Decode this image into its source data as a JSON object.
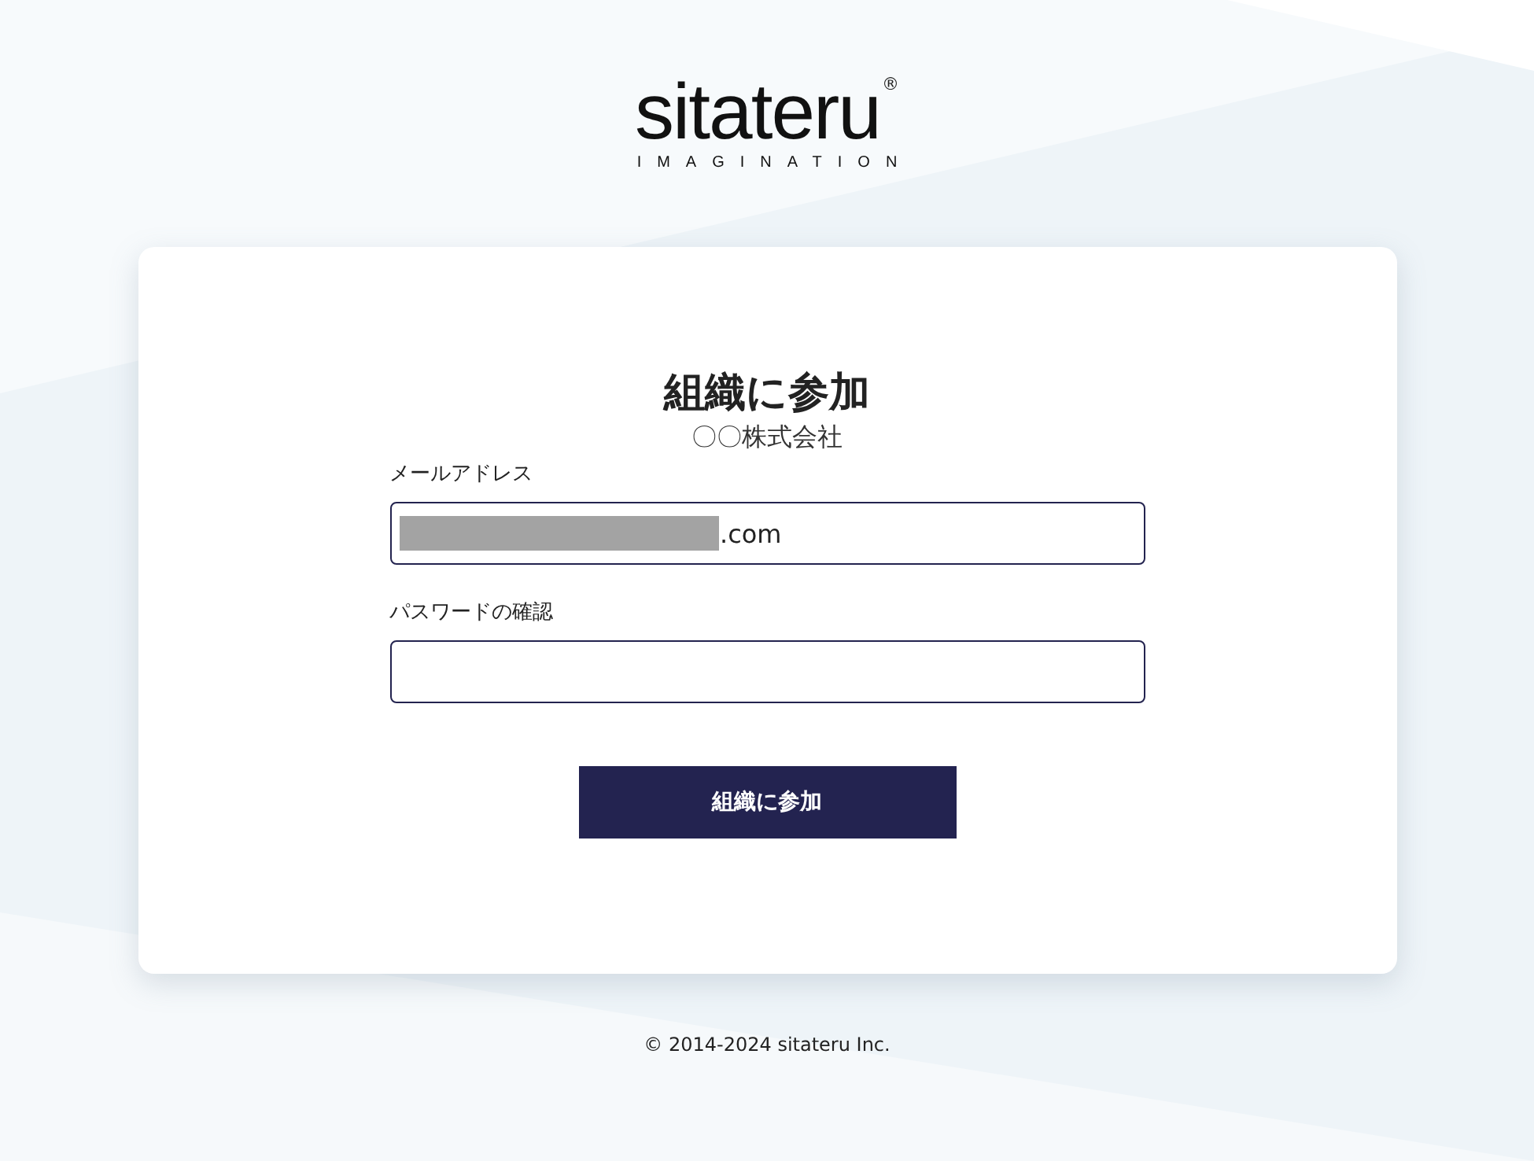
{
  "logo": {
    "wordmark": "sitateru",
    "registered": "®",
    "tagline": "IMAGINATION"
  },
  "card": {
    "title": "組織に参加",
    "organization": "〇〇株式会社",
    "fields": [
      {
        "label": "メールアドレス",
        "value": ".com",
        "redacted": true
      },
      {
        "label": "パスワードの確認",
        "redacted": false
      }
    ],
    "submit_button": "組織に参加"
  },
  "footer": "© 2014-2024 sitateru Inc."
}
